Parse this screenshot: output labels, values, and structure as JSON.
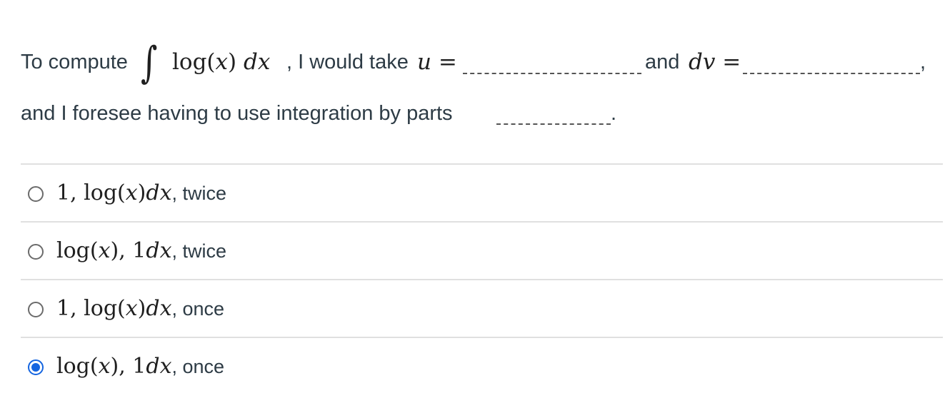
{
  "question": {
    "part1": "To compute",
    "integral_symbol": "∫",
    "integrand": "log(",
    "variable": "x",
    "integrand_close": ") ",
    "differential": "dx",
    "part2": ", I would take ",
    "u_var": "u",
    "equals": " =",
    "part3": "and ",
    "dv_var": "dv",
    "equals2": " =",
    "trailing_comma": ",",
    "line2": "and I foresee having to use integration by parts",
    "period": "."
  },
  "answers": [
    {
      "math": "1, log(",
      "var": "x",
      "math_close": ")",
      "dx": "dx",
      "suffix": ", twice",
      "selected": false
    },
    {
      "math": "log(",
      "var": "x",
      "math_close": "), 1",
      "dx": "dx",
      "suffix": ", twice",
      "selected": false
    },
    {
      "math": "1, log(",
      "var": "x",
      "math_close": ")",
      "dx": "dx",
      "suffix": ", once",
      "selected": false
    },
    {
      "math": "log(",
      "var": "x",
      "math_close": "), 1",
      "dx": "dx",
      "suffix": ", once",
      "selected": true
    }
  ],
  "colors": {
    "accent": "#1565e0",
    "divider": "#e0e0e0",
    "text": "#2d3b45"
  }
}
